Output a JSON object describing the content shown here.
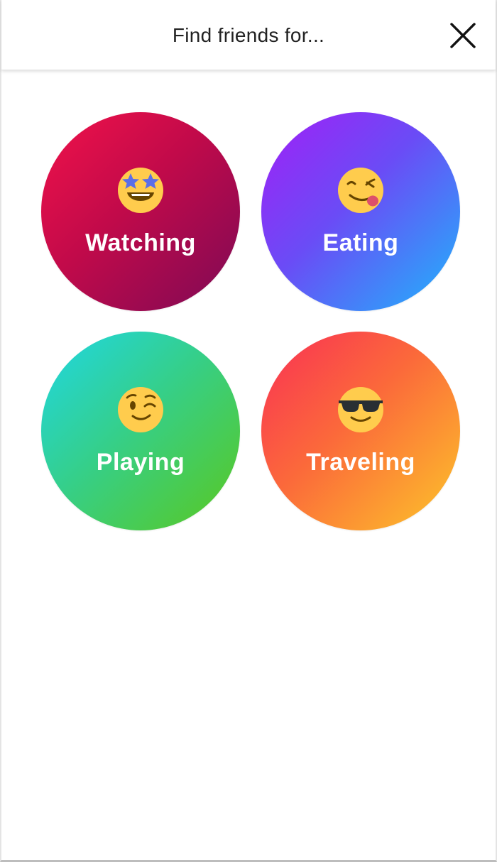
{
  "header": {
    "title": "Find friends for..."
  },
  "categories": [
    {
      "label": "Watching",
      "emoji": "star-struck-icon",
      "gradient": [
        "#f2124a",
        "#7d0a55"
      ]
    },
    {
      "label": "Eating",
      "emoji": "yum-icon",
      "gradient": [
        "#9b2cf7",
        "#1fb6fb"
      ]
    },
    {
      "label": "Playing",
      "emoji": "wink-icon",
      "gradient": [
        "#1fd7e5",
        "#5ac81f"
      ]
    },
    {
      "label": "Traveling",
      "emoji": "sunglasses-icon",
      "gradient": [
        "#fa2f55",
        "#fdc62a"
      ]
    }
  ],
  "colors": {
    "header_text": "#222222",
    "emoji_face": "#ffcc4d",
    "label_text": "#ffffff"
  }
}
